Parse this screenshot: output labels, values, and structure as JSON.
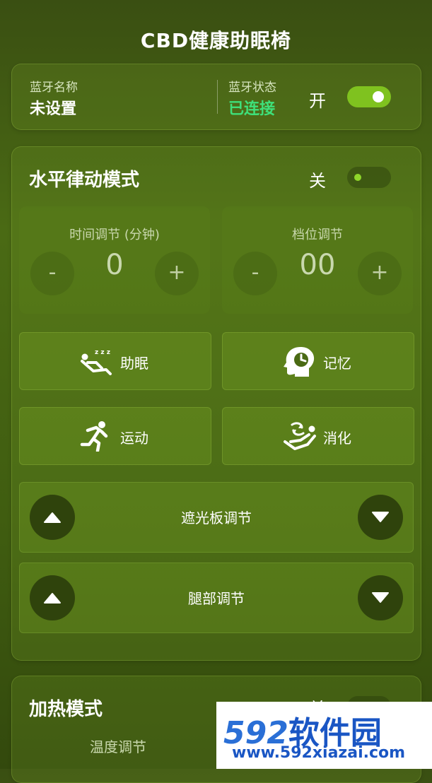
{
  "header": {
    "title": "CBD健康助眠椅"
  },
  "bluetooth": {
    "name_label": "蓝牙名称",
    "name_value": "未设置",
    "status_label": "蓝牙状态",
    "status_value": "已连接",
    "status_color": "#3ee07a",
    "switch_label": "开",
    "switch_on": true
  },
  "rhythm_mode": {
    "title": "水平律动模式",
    "switch_label": "关",
    "switch_on": false,
    "time_adjust": {
      "title": "时间调节 (分钟)",
      "minus": "-",
      "plus": "+",
      "value": "0"
    },
    "gear_adjust": {
      "title": "档位调节",
      "minus": "-",
      "plus": "+",
      "value": "00"
    },
    "functions": [
      {
        "label": "助眠",
        "icon": "sleep-recline-icon"
      },
      {
        "label": "记忆",
        "icon": "head-clock-icon"
      },
      {
        "label": "运动",
        "icon": "running-icon"
      },
      {
        "label": "消化",
        "icon": "digest-recline-icon"
      }
    ],
    "sliders": [
      {
        "label": "遮光板调节"
      },
      {
        "label": "腿部调节"
      }
    ]
  },
  "heat_mode": {
    "title": "加热模式",
    "switch_label": "关",
    "temp_label": "温度调节"
  },
  "watermark": {
    "number": "592",
    "brand": "软件园",
    "url": "www.592xiazai.com"
  }
}
